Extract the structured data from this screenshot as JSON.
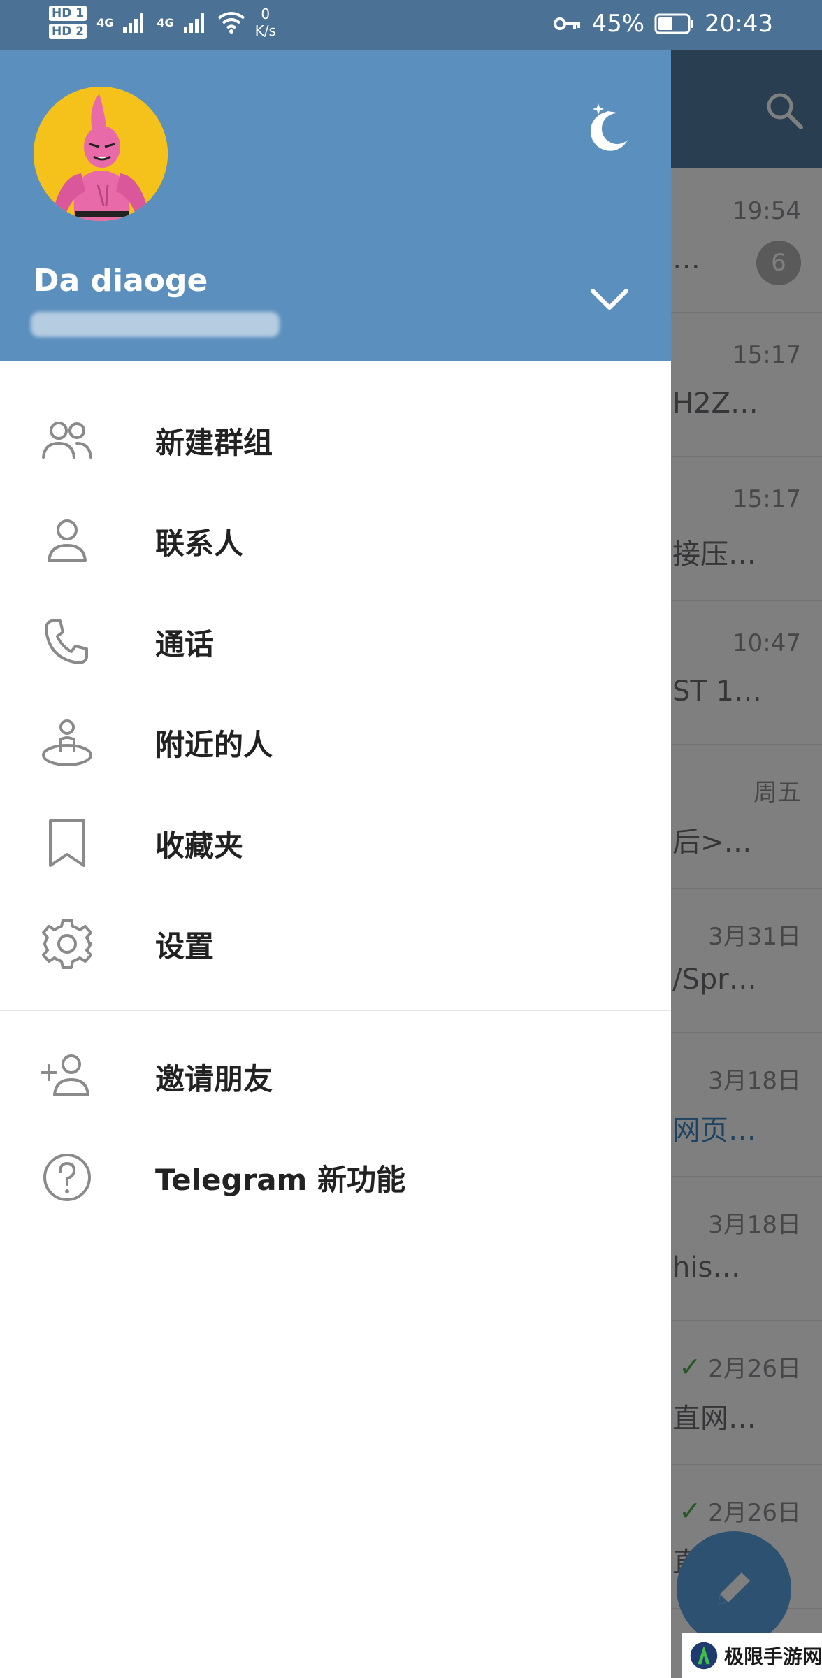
{
  "status_bar": {
    "sim1": "HD 1",
    "sim2": "HD 2",
    "net1": "4G",
    "net2": "4G",
    "speed_value": "0",
    "speed_unit": "K/s",
    "battery": "45%",
    "time": "20:43"
  },
  "drawer": {
    "user_name": "Da diaoge",
    "menu": [
      {
        "label": "新建群组",
        "icon": "group-icon"
      },
      {
        "label": "联系人",
        "icon": "contact-icon"
      },
      {
        "label": "通话",
        "icon": "phone-icon"
      },
      {
        "label": "附近的人",
        "icon": "people-nearby-icon"
      },
      {
        "label": "收藏夹",
        "icon": "bookmark-icon"
      },
      {
        "label": "设置",
        "icon": "gear-icon"
      }
    ],
    "menu_secondary": [
      {
        "label": "邀请朋友",
        "icon": "add-user-icon"
      },
      {
        "label": "Telegram 新功能",
        "icon": "help-icon"
      }
    ]
  },
  "chat_list": [
    {
      "time": "19:54",
      "preview": "…",
      "badge": "6"
    },
    {
      "time": "15:17",
      "preview": "H2Z…"
    },
    {
      "time": "15:17",
      "preview": "接压…"
    },
    {
      "time": "10:47",
      "preview": "ST 1…"
    },
    {
      "time": "周五",
      "preview": "后>…"
    },
    {
      "time": "3月31日",
      "preview": "/Spr…"
    },
    {
      "time": "3月18日",
      "preview": "网页…",
      "link": true
    },
    {
      "time": "3月18日",
      "preview": "his…"
    },
    {
      "time": "2月26日",
      "preview": "直网…",
      "check": "✓"
    },
    {
      "time": "2月26日",
      "preview": "直…",
      "check": "✓"
    }
  ],
  "watermark": {
    "text": "极限手游网"
  },
  "colors": {
    "drawer_header": "#5b8fbd",
    "status_bar": "#4b7195",
    "fab": "#5aa3e0",
    "avatar_bg": "#f4c21b"
  }
}
